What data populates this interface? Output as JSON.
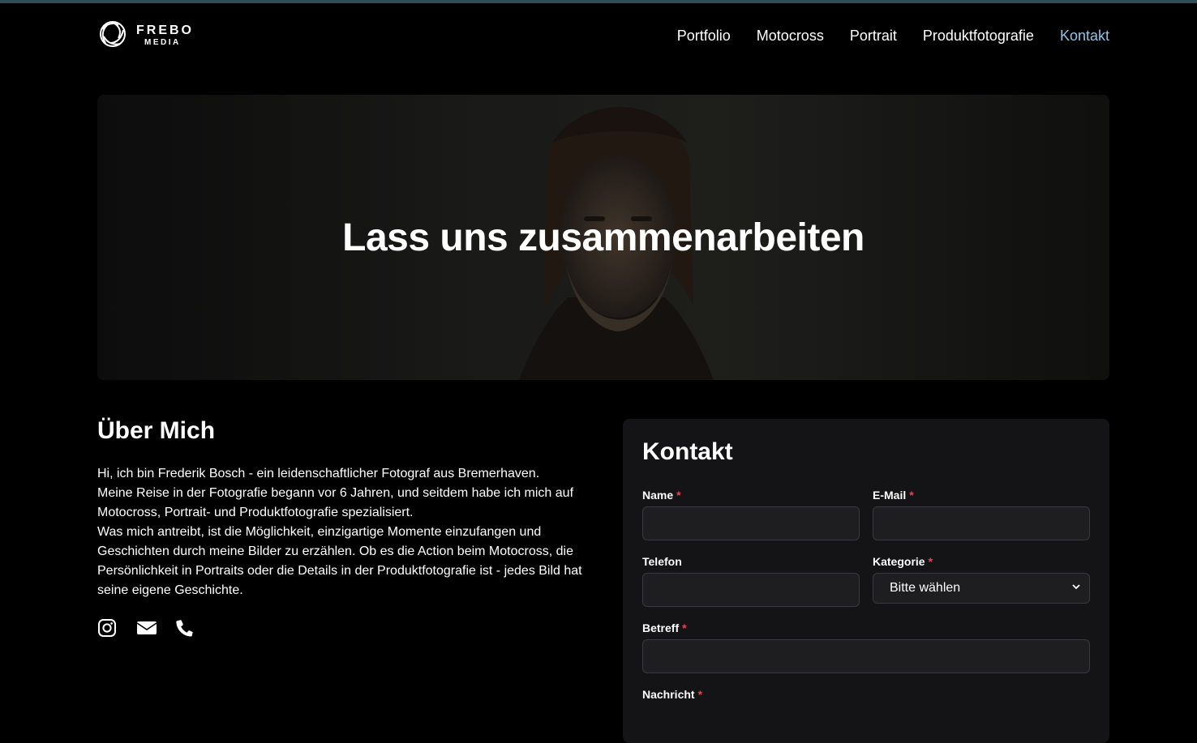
{
  "brand": {
    "name": "FREBO",
    "sub": "MEDIA"
  },
  "nav": {
    "items": [
      {
        "label": "Portfolio"
      },
      {
        "label": "Motocross"
      },
      {
        "label": "Portrait"
      },
      {
        "label": "Produktfotografie"
      },
      {
        "label": "Kontakt",
        "active": true
      }
    ]
  },
  "hero": {
    "title": "Lass uns zusammenarbeiten"
  },
  "about": {
    "title": "Über Mich",
    "text": "Hi, ich bin Frederik Bosch - ein leidenschaftlicher Fotograf aus Bremerhaven.\nMeine Reise in der Fotografie begann vor 6 Jahren, und seitdem habe ich mich auf Motocross, Portrait- und Produktfotografie spezialisiert.\nWas mich antreibt, ist die Möglichkeit, einzigartige Momente einzufangen und Geschichten durch meine Bilder zu erzählen. Ob es die Action beim Motocross, die Persönlichkeit in Portraits oder die Details in der Produktfotografie ist - jedes Bild hat seine eigene Geschichte.",
    "socials": [
      "instagram-icon",
      "envelope-icon",
      "phone-icon"
    ]
  },
  "contact": {
    "title": "Kontakt",
    "required_mark": "*",
    "fields": {
      "name": {
        "label": "Name",
        "value": ""
      },
      "email": {
        "label": "E-Mail",
        "value": ""
      },
      "phone": {
        "label": "Telefon",
        "value": ""
      },
      "category": {
        "label": "Kategorie",
        "selected": "Bitte wählen"
      },
      "subject": {
        "label": "Betreff",
        "value": ""
      },
      "message": {
        "label": "Nachricht"
      }
    }
  },
  "colors": {
    "background": "#000000",
    "accent": "#8ec4e6",
    "required": "#e0474f",
    "card": "#141416"
  }
}
